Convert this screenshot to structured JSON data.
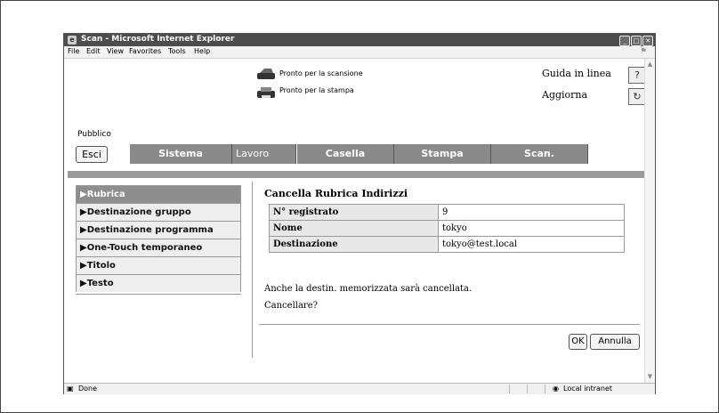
{
  "window": {
    "title": "Scan - Microsoft Internet Explorer",
    "menu": [
      "File",
      "Edit",
      "View",
      "Favorites",
      "Tools",
      "Help"
    ]
  },
  "header": {
    "status_scan": "Pronto per la scansione",
    "status_print": "Pronto per la stampa",
    "help_label": "Guida in linea",
    "refresh_label": "Aggiorna",
    "user_mode": "Pubblico",
    "help_icon_glyph": "?",
    "refresh_icon_glyph": "↻"
  },
  "nav": {
    "exit_label": "Esci",
    "tabs": [
      "Sistema",
      "Lavoro",
      "Casella",
      "Stampa",
      "Scan."
    ]
  },
  "sidebar": {
    "items": [
      {
        "label": "▶Rubrica",
        "selected": true
      },
      {
        "label": "▶Destinazione gruppo"
      },
      {
        "label": "▶Destinazione programma"
      },
      {
        "label": "▶One-Touch temporaneo"
      },
      {
        "label": "▶Titolo"
      },
      {
        "label": "▶Testo"
      }
    ]
  },
  "main": {
    "title": "Cancella Rubrica Indirizzi",
    "rows": [
      {
        "label": "N° registrato",
        "value": "9"
      },
      {
        "label": "Nome",
        "value": "tokyo"
      },
      {
        "label": "Destinazione",
        "value": "tokyo@test.local"
      }
    ],
    "message_line1": "Anche la destin. memorizzata sarà cancellata.",
    "message_line2": "Cancellare?",
    "ok_label": "OK",
    "cancel_label": "Annulla"
  },
  "statusbar": {
    "left": "Done",
    "zone": "Local intranet"
  },
  "colors": {
    "tab_bg": "#8a8a8a",
    "selected_item_bg": "#8e8e8e"
  }
}
